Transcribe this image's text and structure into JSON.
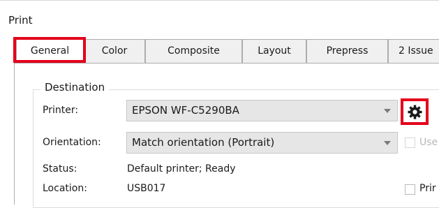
{
  "window": {
    "title": "Print"
  },
  "tabs": [
    {
      "label": "General"
    },
    {
      "label": "Color"
    },
    {
      "label": "Composite"
    },
    {
      "label": "Layout"
    },
    {
      "label": "Prepress"
    },
    {
      "label": "2 Issue"
    }
  ],
  "destination": {
    "legend": "Destination",
    "printer_label": "Printer:",
    "printer_value": "EPSON WF-C5290BA",
    "orientation_label": "Orientation:",
    "orientation_value": "Match orientation (Portrait)",
    "status_label": "Status:",
    "status_value": "Default printer; Ready",
    "location_label": "Location:",
    "location_value": "USB017"
  },
  "right_options": {
    "use_label": "Use",
    "print_label": "Prir"
  },
  "icons": {
    "settings": "gear-icon",
    "dropdown": "chevron-down-icon"
  },
  "colors": {
    "highlight": "#e4001b"
  }
}
